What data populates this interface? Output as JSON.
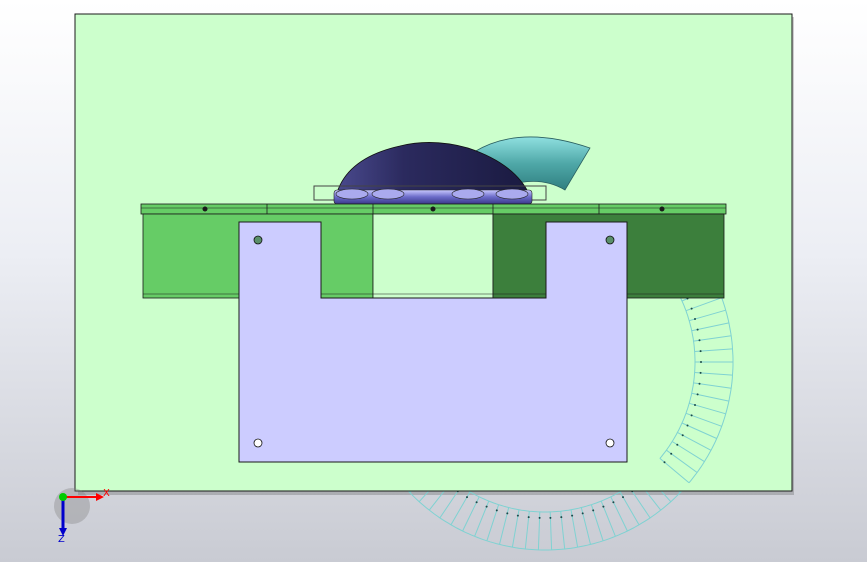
{
  "triad": {
    "x_label": "X",
    "z_label": "Z"
  },
  "colors": {
    "viewport_top": "#ffffff",
    "viewport_bottom": "#c9cbd3",
    "base_plate": "#ccffcc",
    "beam_light_green": "#66cc66",
    "beam_dark_green": "#3a7f3a",
    "bracket_plate": "#ccccff",
    "dome": "#2b2a5e",
    "elbow_pipe": "#5fb8b8",
    "rollers": "#7e7ed0",
    "conveyor_track": "#7fd2d2",
    "axis_x": "#ff0000",
    "axis_y": "#00cc00",
    "axis_z": "#0000cc"
  },
  "icons": {
    "triad": "coordinate-triad-icon"
  }
}
